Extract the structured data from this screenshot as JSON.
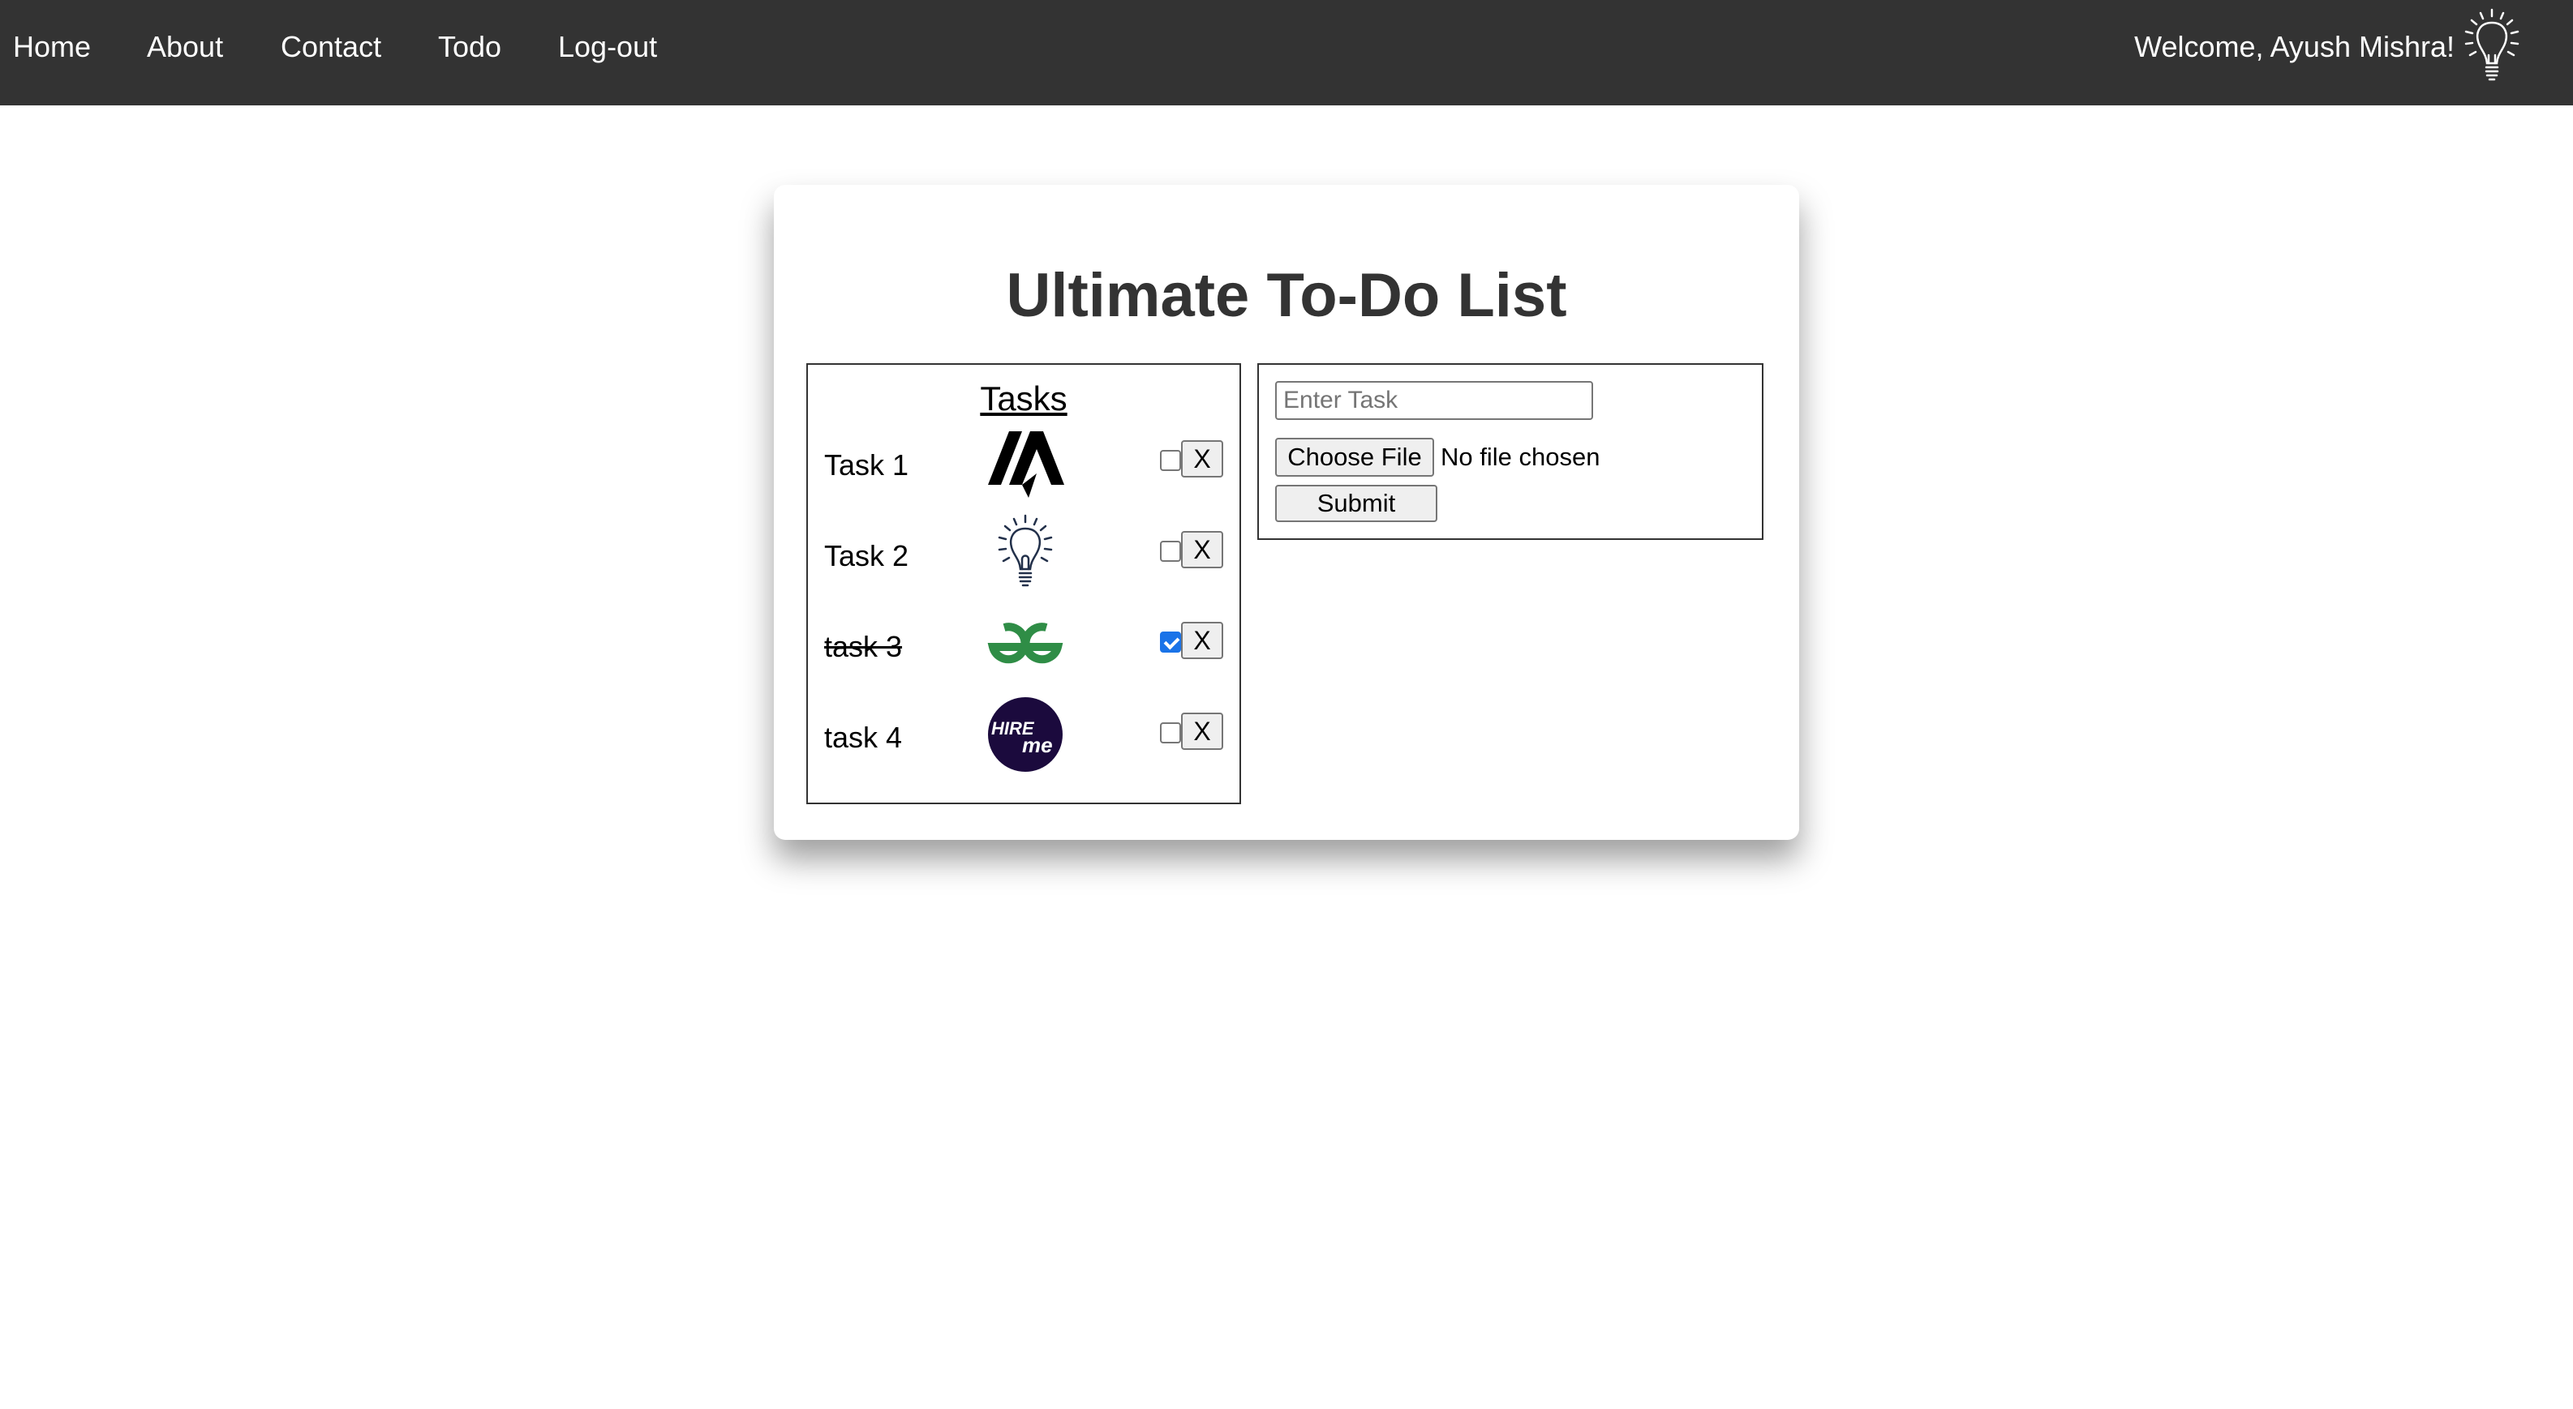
{
  "nav": {
    "links": [
      "Home",
      "About",
      "Contact",
      "Todo",
      "Log-out"
    ],
    "welcome": "Welcome, Ayush Mishra!",
    "bulb_icon": "lightbulb-icon"
  },
  "card": {
    "title": "Ultimate To-Do List"
  },
  "tasks": {
    "heading": "Tasks",
    "delete_label": "X",
    "items": [
      {
        "label": "Task 1",
        "completed": false,
        "logo": "ma-logo-icon"
      },
      {
        "label": "Task 2",
        "completed": false,
        "logo": "lightbulb-icon"
      },
      {
        "label": "task 3",
        "completed": true,
        "logo": "gfg-logo-icon"
      },
      {
        "label": "task 4",
        "completed": false,
        "logo": "hire-me-logo-icon"
      }
    ]
  },
  "form": {
    "task_placeholder": "Enter Task",
    "task_value": "",
    "choose_file_label": "Choose File",
    "file_status": "No file chosen",
    "submit_label": "Submit"
  },
  "colors": {
    "navbar": "#333333",
    "title": "#333333",
    "check_accent": "#1a73e8",
    "gfg_green": "#2f8d46",
    "hireme_purple": "#1b0a3d"
  }
}
